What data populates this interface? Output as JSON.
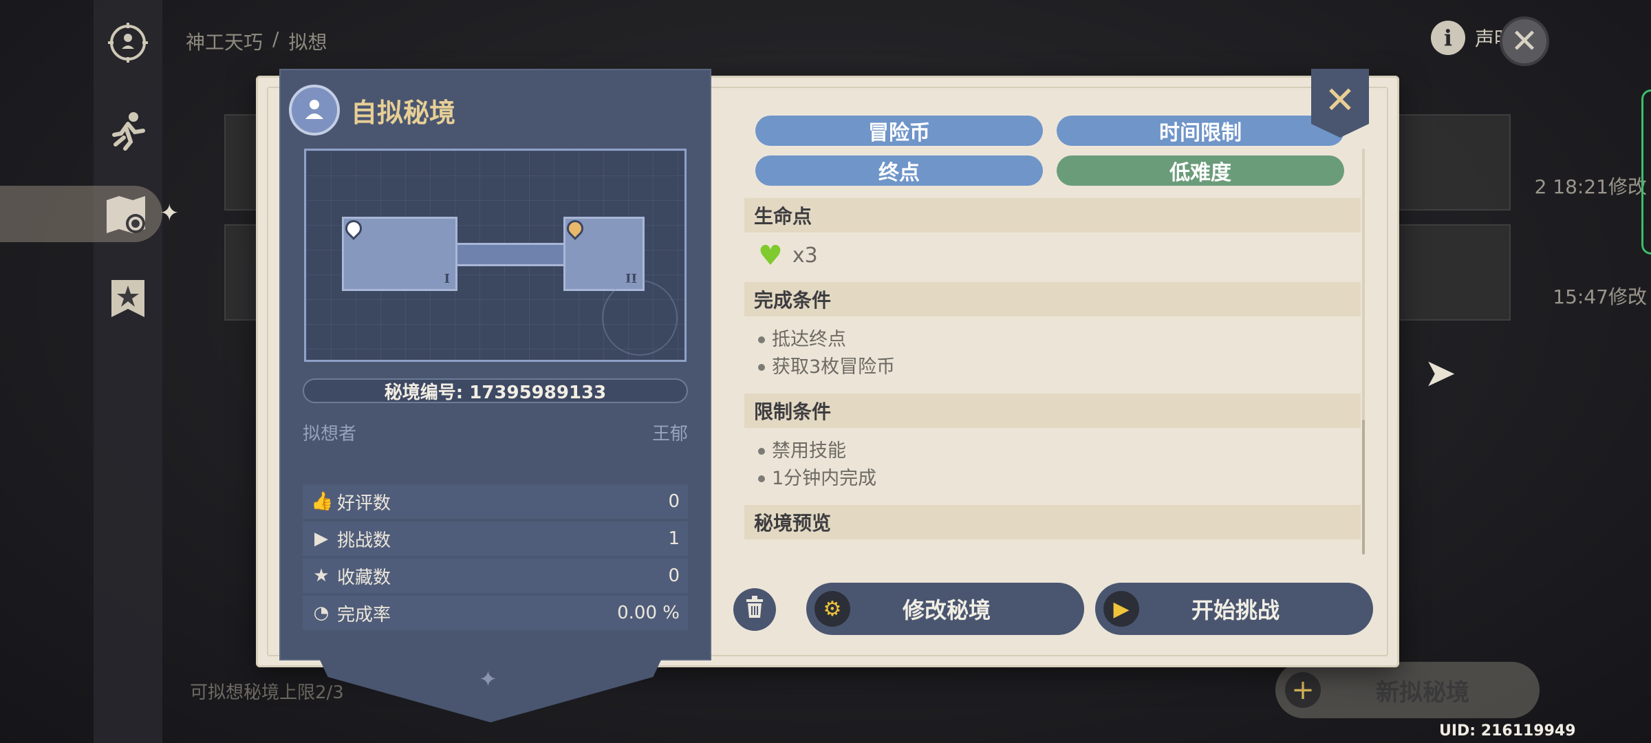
{
  "breadcrumb": {
    "root": "神工天巧",
    "separator": "/",
    "current": "拟想"
  },
  "top_bar": {
    "info_glyph": "i",
    "statement_label": "声明",
    "close_glyph": "✕"
  },
  "nav": {
    "items": [
      {
        "name": "compass-icon",
        "glyph": "◎"
      },
      {
        "name": "runner-icon",
        "glyph": "🏃"
      },
      {
        "name": "map-gear-icon",
        "glyph": "🗺"
      },
      {
        "name": "star-badge-icon",
        "glyph": "★"
      }
    ],
    "active_index": 2
  },
  "background_list": {
    "items": [
      {
        "time": "2 18:21修改"
      },
      {
        "time": "15:47修改"
      }
    ],
    "footer_text": "可拟想秘境上限2/3",
    "new_button_label": "新拟秘境",
    "uid": "UID: 216119949"
  },
  "panel": {
    "title": "自拟秘境",
    "room_labels": [
      "I",
      "II"
    ],
    "domain_id_label": "秘境编号: 17395989133",
    "creator_label": "拟想者",
    "creator_name": "王郁",
    "stats": [
      {
        "icon": "thumbs-up-icon",
        "glyph": "👍",
        "label": "好评数",
        "value": "0"
      },
      {
        "icon": "play-icon",
        "glyph": "▶",
        "label": "挑战数",
        "value": "1"
      },
      {
        "icon": "star-icon",
        "glyph": "★",
        "label": "收藏数",
        "value": "0"
      },
      {
        "icon": "pie-icon",
        "glyph": "◔",
        "label": "完成率",
        "value": "0.00 %"
      }
    ]
  },
  "tags": [
    {
      "label": "冒险币",
      "color": "#6f95c9"
    },
    {
      "label": "时间限制",
      "color": "#6f95c9"
    },
    {
      "label": "终点",
      "color": "#6f95c9"
    },
    {
      "label": "低难度",
      "color": "#6b9c7a"
    }
  ],
  "details": {
    "hp_title": "生命点",
    "hp_value": "x3",
    "completion_title": "完成条件",
    "completion_items": [
      "抵达终点",
      "获取3枚冒险币"
    ],
    "restriction_title": "限制条件",
    "restriction_items": [
      "禁用技能",
      "1分钟内完成"
    ],
    "preview_title": "秘境预览"
  },
  "actions": {
    "delete_glyph": "🗑",
    "modify_label": "修改秘境",
    "start_label": "开始挑战"
  },
  "colors": {
    "panel_bg": "#4a5670",
    "accent_gold": "#e7cf96",
    "tag_blue": "#6f95c9",
    "tag_green": "#6b9c7a",
    "heart_green": "#7fca2e"
  }
}
